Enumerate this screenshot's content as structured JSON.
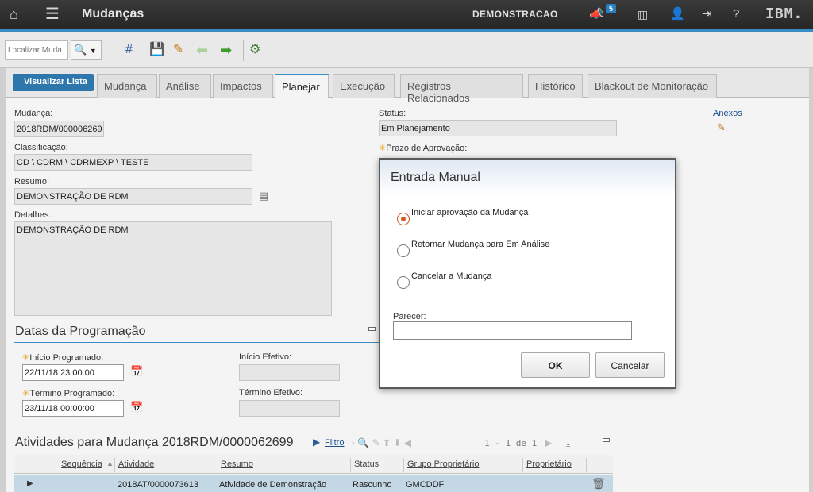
{
  "header": {
    "title": "Mudanças",
    "org": "DEMONSTRACAO",
    "notifications_count": "5",
    "brand": "IBM."
  },
  "toolbar": {
    "search_placeholder": "Localizar Muda"
  },
  "nav": {
    "back_label": "Visualizar Lista",
    "tabs": [
      "Mudança",
      "Análise",
      "Impactos",
      "Planejar",
      "Execução",
      "Registros Relacionados",
      "Histórico",
      "Blackout de Monitoração"
    ],
    "active_tab": "Planejar"
  },
  "form": {
    "change_label": "Mudança:",
    "change_value": "2018RDM/000006269",
    "class_label": "Classificação:",
    "class_value": "CD \\ CDRM \\ CDRMEXP \\ TESTE",
    "summary_label": "Resumo:",
    "summary_value": "DEMONSTRAÇÃO DE RDM",
    "details_label": "Detalhes:",
    "details_value": "DEMONSTRAÇÃO DE RDM",
    "status_label": "Status:",
    "status_value": "Em Planejamento",
    "approval_label": "Prazo de Aprovação:",
    "attachments_label": "Anexos"
  },
  "schedule": {
    "title": "Datas da Programação",
    "start_label": "Início Programado:",
    "start_value": "22/11/18 23:00:00",
    "end_label": "Término Programado:",
    "end_value": "23/11/18 00:00:00",
    "actual_start_label": "Início Efetivo:",
    "actual_end_label": "Término Efetivo:"
  },
  "activities": {
    "title": "Atividades para Mudança 2018RDM/0000062699",
    "filter_label": "Filtro",
    "pagination": "1 - 1 de 1",
    "columns": [
      "Sequência",
      "Atividade",
      "Resumo",
      "Status",
      "Grupo Proprietário",
      "Proprietário"
    ],
    "rows": [
      {
        "sequence": "",
        "activity": "2018AT/0000073613",
        "summary": "Atividade de Demonstração",
        "status": "Rascunho",
        "group": "GMCDDF",
        "owner": ""
      }
    ]
  },
  "dialog": {
    "title": "Entrada Manual",
    "options": [
      "Iniciar aprovação da Mudança",
      "Retornar Mudança para Em Análise",
      "Cancelar a Mudança"
    ],
    "selected_option": 0,
    "opinion_label": "Parecer:",
    "opinion_value": "",
    "ok_label": "OK",
    "cancel_label": "Cancelar"
  },
  "colors": {
    "accent": "#3a8cc4",
    "back_button": "#2e77ad",
    "selected_row": "#c4d7e4",
    "radio_selected": "#d35a1c"
  }
}
